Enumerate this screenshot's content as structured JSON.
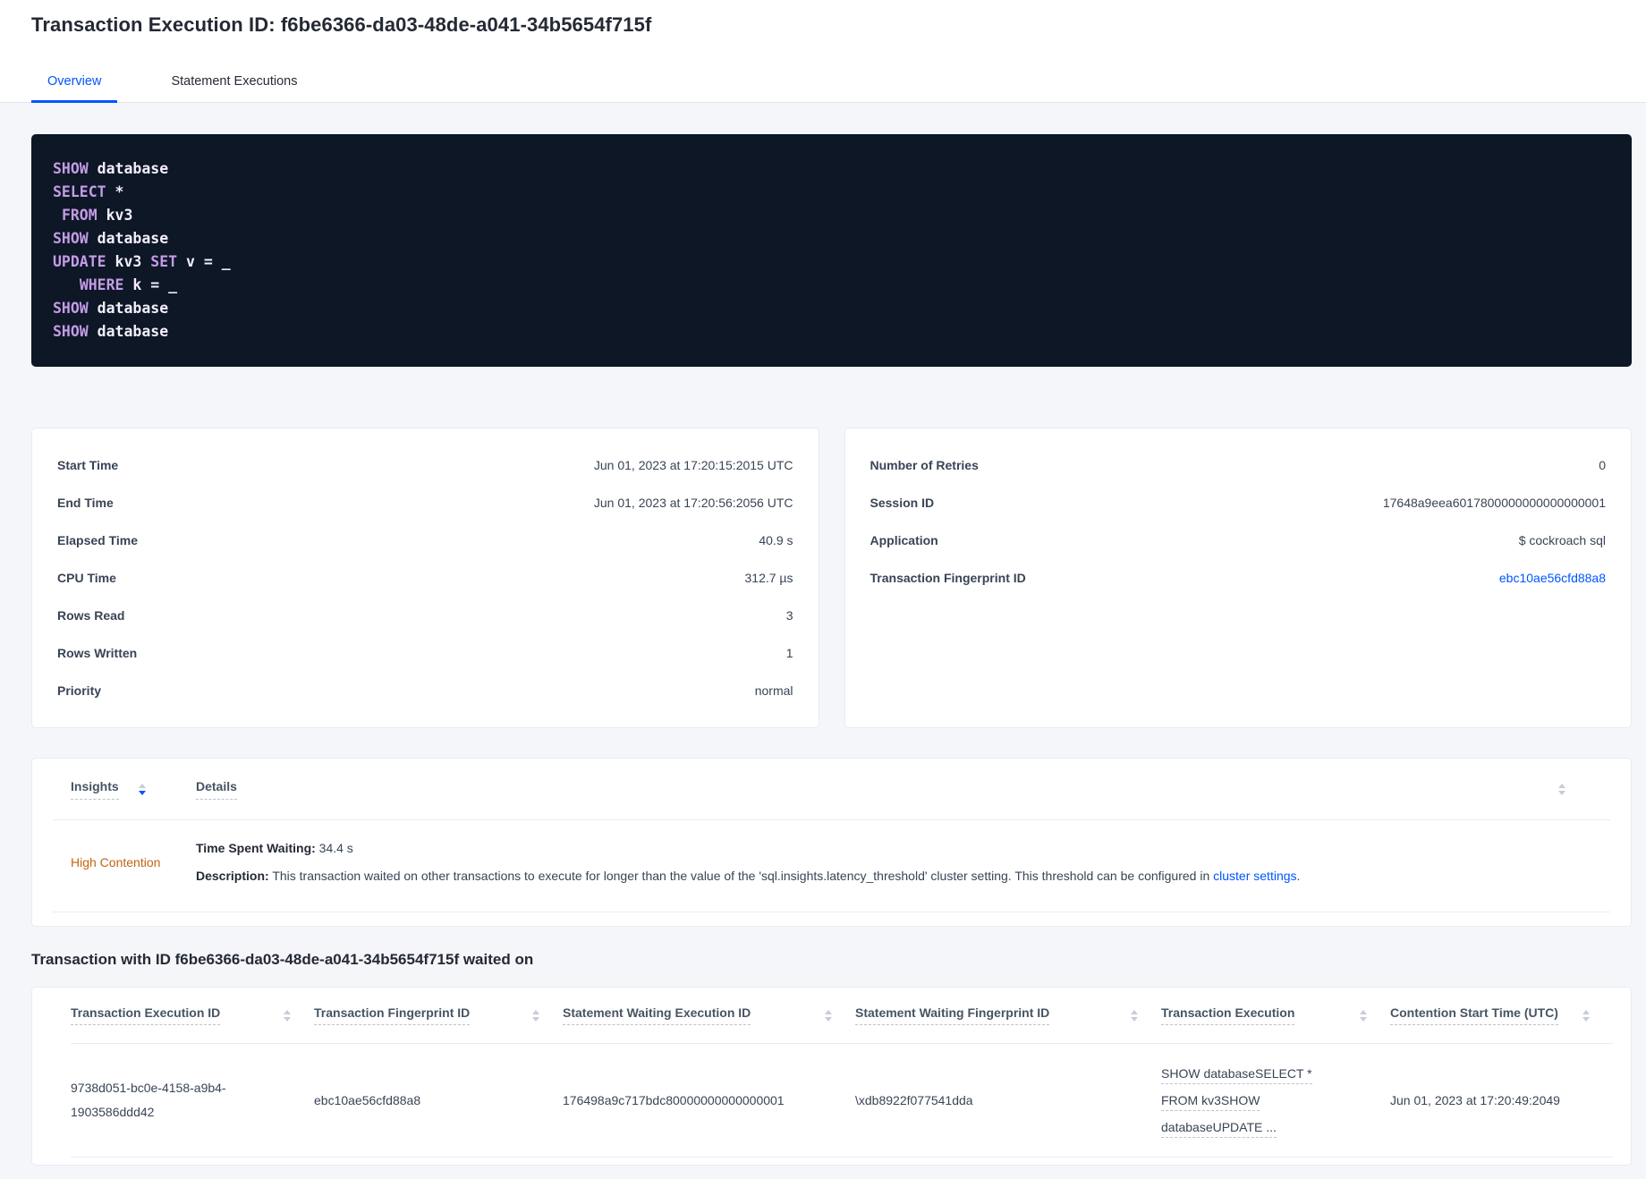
{
  "colors": {
    "page_bg": "#f4f6fa",
    "accent": "#0055ff",
    "heading": "#242a35",
    "text": "#394455",
    "label": "#475464",
    "divider": "#e0e5eb",
    "card_border": "#e7ecf3",
    "code_bg": "#0d1726",
    "code_text": "#f3eefc",
    "code_keyword": "#c49ce6",
    "warning": "#c26410",
    "sort_gray": "#c7cdd6",
    "dash": "#b9c3cf"
  },
  "page": {
    "title": "Transaction Execution ID: f6be6366-da03-48de-a041-34b5654f715f",
    "tabs": [
      {
        "label": "Overview",
        "active": true
      },
      {
        "label": "Statement Executions",
        "active": false
      }
    ]
  },
  "sql": {
    "lines": [
      [
        {
          "k": true,
          "t": "SHOW"
        },
        {
          "k": false,
          "t": " database"
        }
      ],
      [
        {
          "k": true,
          "t": "SELECT"
        },
        {
          "k": false,
          "t": " *"
        }
      ],
      [
        {
          "k": false,
          "t": " "
        },
        {
          "k": true,
          "t": "FROM"
        },
        {
          "k": false,
          "t": " kv3"
        }
      ],
      [
        {
          "k": true,
          "t": "SHOW"
        },
        {
          "k": false,
          "t": " database"
        }
      ],
      [
        {
          "k": true,
          "t": "UPDATE"
        },
        {
          "k": false,
          "t": " kv3 "
        },
        {
          "k": true,
          "t": "SET"
        },
        {
          "k": false,
          "t": " v = _"
        }
      ],
      [
        {
          "k": false,
          "t": "   "
        },
        {
          "k": true,
          "t": "WHERE"
        },
        {
          "k": false,
          "t": " k = _"
        }
      ],
      [
        {
          "k": true,
          "t": "SHOW"
        },
        {
          "k": false,
          "t": " database"
        }
      ],
      [
        {
          "k": true,
          "t": "SHOW"
        },
        {
          "k": false,
          "t": " database"
        }
      ]
    ]
  },
  "summary_left": {
    "rows": [
      {
        "label": "Start Time",
        "value": "Jun 01, 2023 at 17:20:15:2015 UTC",
        "link": false
      },
      {
        "label": "End Time",
        "value": "Jun 01, 2023 at 17:20:56:2056 UTC",
        "link": false
      },
      {
        "label": "Elapsed Time",
        "value": "40.9 s",
        "link": false
      },
      {
        "label": "CPU Time",
        "value": "312.7 µs",
        "link": false
      },
      {
        "label": "Rows Read",
        "value": "3",
        "link": false
      },
      {
        "label": "Rows Written",
        "value": "1",
        "link": false
      },
      {
        "label": "Priority",
        "value": "normal",
        "link": false
      }
    ]
  },
  "summary_right": {
    "rows": [
      {
        "label": "Number of Retries",
        "value": "0",
        "link": false
      },
      {
        "label": "Session ID",
        "value": "17648a9eea6017800000000000000001",
        "link": false
      },
      {
        "label": "Application",
        "value": "$ cockroach sql",
        "link": false
      },
      {
        "label": "Transaction Fingerprint ID",
        "value": "ebc10ae56cfd88a8",
        "link": true
      }
    ]
  },
  "insights": {
    "col_insights": "Insights",
    "col_details": "Details",
    "row": {
      "name": "High Contention",
      "waiting_label": "Time Spent Waiting:",
      "waiting_value": " 34.4 s",
      "description_label": "Description:",
      "description_text": " This transaction waited on other transactions to execute for longer than the value of the 'sql.insights.latency_threshold' cluster setting. This threshold can be configured in ",
      "description_link": "cluster settings",
      "description_suffix": "."
    }
  },
  "waited": {
    "heading": "Transaction with ID f6be6366-da03-48de-a041-34b5654f715f waited on",
    "columns": [
      "Transaction Execution ID",
      "Transaction Fingerprint ID",
      "Statement Waiting Execution ID",
      "Statement Waiting Fingerprint ID",
      "Transaction Execution",
      "Contention Start Time (UTC)"
    ],
    "row": {
      "transaction_execution_id": "9738d051-bc0e-4158-a9b4-1903586ddd42",
      "transaction_fingerprint_id": "ebc10ae56cfd88a8",
      "statement_waiting_execution_id": "176498a9c717bdc80000000000000001",
      "statement_waiting_fingerprint_id": "\\xdb8922f077541dda",
      "transaction_execution_lines": [
        "SHOW databaseSELECT *",
        "FROM kv3SHOW",
        "databaseUPDATE ..."
      ],
      "contention_start_time": "Jun 01, 2023 at 17:20:49:2049"
    }
  }
}
